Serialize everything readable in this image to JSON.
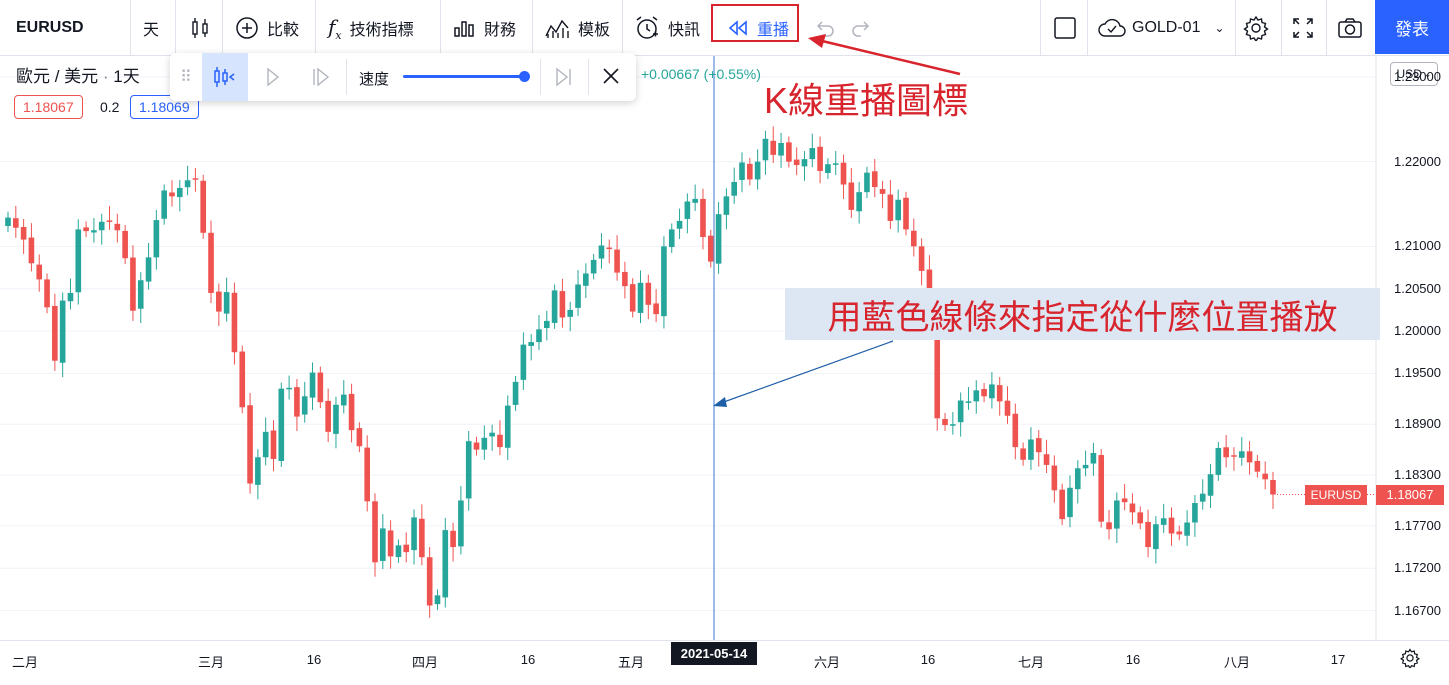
{
  "toolbar": {
    "symbol": "EURUSD",
    "interval": "天",
    "compare": "比較",
    "indicators": "技術指標",
    "financials": "財務",
    "templates": "模板",
    "alerts": "快訊",
    "replay": "重播",
    "layout_name": "GOLD-01",
    "publish": "發表"
  },
  "replay_panel": {
    "speed_label": "速度",
    "speed_value": 1.0
  },
  "legend": {
    "title": "歐元 / 美元",
    "interval": "1天",
    "change": "+0.00667 (+0.55%)",
    "bid": "1.18067",
    "spread": "0.2",
    "ask": "1.18069"
  },
  "annotations": {
    "replay_icon_note": "K線重播圖標",
    "blue_line_note": "用藍色線條來指定從什麼位置播放"
  },
  "price_axis": {
    "currency": "USD",
    "last_symbol": "EURUSD",
    "last_price": "1.18067"
  },
  "colors": {
    "up": "#26a69a",
    "down": "#ef5350",
    "accent": "#2962ff",
    "annotation": "#d7242d"
  },
  "chart_data": {
    "type": "candlestick",
    "ylim": [
      1.164,
      1.232
    ],
    "yticks": [
      "1.23000",
      "1.22000",
      "1.21000",
      "1.20500",
      "1.20000",
      "1.19500",
      "1.18900",
      "1.18300",
      "1.17700",
      "1.17200",
      "1.16700"
    ],
    "xticks": [
      "二月",
      "三月",
      "16",
      "四月",
      "16",
      "五月",
      "2021-05-14",
      "六月",
      "16",
      "七月",
      "16",
      "八月",
      "17"
    ],
    "replay_start": "2021-05-14",
    "closes": [
      1.2134,
      1.2122,
      1.2108,
      1.208,
      1.2061,
      1.2028,
      1.1965,
      1.2036,
      1.2045,
      1.212,
      1.2118,
      1.2119,
      1.2129,
      1.2129,
      1.2119,
      1.2086,
      1.2024,
      1.206,
      1.2087,
      1.2131,
      1.2166,
      1.2159,
      1.2169,
      1.2178,
      1.2179,
      1.2116,
      1.2045,
      1.2023,
      1.2046,
      1.1975,
      1.191,
      1.182,
      1.1851,
      1.1881,
      1.1849,
      1.1932,
      1.1933,
      1.1899,
      1.1923,
      1.1951,
      1.1916,
      1.1881,
      1.1913,
      1.1925,
      1.1883,
      1.1864,
      1.1799,
      1.1727,
      1.1767,
      1.1734,
      1.1747,
      1.1739,
      1.178,
      1.1733,
      1.1676,
      1.1688,
      1.1765,
      1.1745,
      1.18,
      1.187,
      1.186,
      1.1874,
      1.188,
      1.1863,
      1.1912,
      1.194,
      1.1984,
      1.1987,
      1.2002,
      1.2012,
      1.2048,
      1.2016,
      1.2025,
      1.2055,
      1.2068,
      1.2084,
      1.2101,
      1.2097,
      1.2069,
      1.2053,
      1.2023,
      1.2057,
      1.2031,
      1.202,
      1.21,
      1.212,
      1.213,
      1.2153,
      1.2156,
      1.2111,
      1.2082,
      1.2138,
      1.2159,
      1.2176,
      1.2199,
      1.2179,
      1.22,
      1.2227,
      1.2208,
      1.2222,
      1.22,
      1.2196,
      1.2203,
      1.2216,
      1.2189,
      1.2197,
      1.2198,
      1.2173,
      1.2143,
      1.2164,
      1.2187,
      1.217,
      1.2162,
      1.213,
      1.2155,
      1.212,
      1.21,
      1.2071,
      1.2014,
      1.1897,
      1.1889,
      1.189,
      1.1918,
      1.1917,
      1.193,
      1.1923,
      1.1937,
      1.1917,
      1.19,
      1.1863,
      1.1848,
      1.1872,
      1.1857,
      1.1842,
      1.1812,
      1.1778,
      1.1815,
      1.1838,
      1.1842,
      1.1856,
      1.1775,
      1.1766,
      1.18,
      1.1798,
      1.1786,
      1.1773,
      1.1745,
      1.1772,
      1.1779,
      1.1761,
      1.176,
      1.1774,
      1.1797,
      1.1808,
      1.1831,
      1.1862,
      1.1851,
      1.1852,
      1.1858,
      1.1845,
      1.1834,
      1.1825,
      1.1807
    ]
  }
}
